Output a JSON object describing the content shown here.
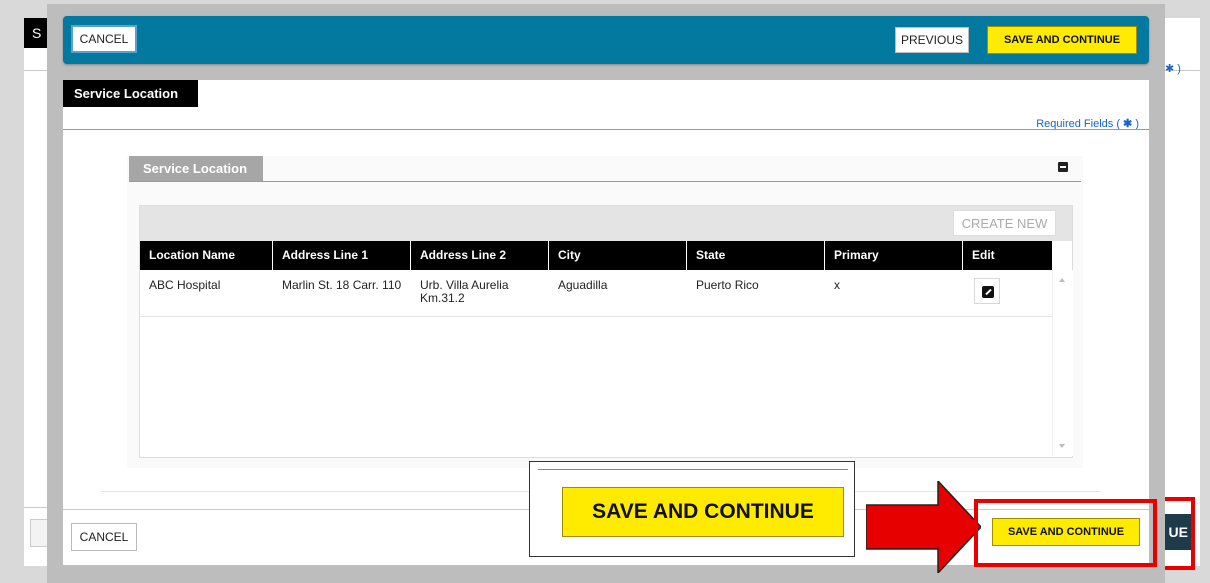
{
  "background": {
    "tab_fragment": "S",
    "required_fragment": "✱ )",
    "button_fragment": "UE"
  },
  "modal": {
    "header": {
      "cancel_label": "CANCEL",
      "previous_label": "PREVIOUS",
      "save_continue_label": "SAVE AND CONTINUE"
    },
    "section_title": "Service Location",
    "required_fields_label": "Required Fields (",
    "required_star": "✱",
    "required_close": ")",
    "panel": {
      "title": "Service Location",
      "collapse_icon": "minus-square-icon",
      "create_new_label": "CREATE NEW",
      "columns": [
        "Location Name",
        "Address Line 1",
        "Address Line 2",
        "City",
        "State",
        "Primary",
        "Edit"
      ],
      "rows": [
        {
          "location_name": "ABC Hospital",
          "address_line_1": "Marlin St. 18 Carr. 110",
          "address_line_2": "Urb. Villa Aurelia Km.31.2",
          "city": "Aguadilla",
          "state": "Puerto Rico",
          "primary": "x",
          "edit_icon": "edit-pencil-icon"
        }
      ]
    },
    "footer": {
      "cancel_label": "CANCEL",
      "save_continue_label": "SAVE AND CONTINUE"
    }
  },
  "annotation": {
    "zoom_label": "SAVE AND CONTINUE",
    "arrow_icon": "right-arrow-icon",
    "highlight_color": "#e60000"
  },
  "colors": {
    "header_blue": "#04799f",
    "button_yellow": "#ffeb00",
    "overlay_gray": "#bdbdbd"
  }
}
